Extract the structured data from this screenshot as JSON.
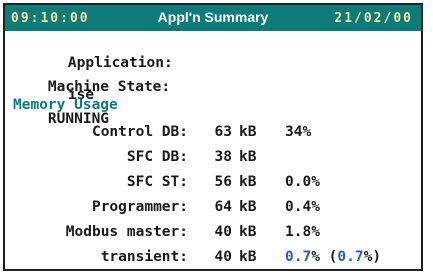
{
  "header": {
    "time": "09:10:00",
    "title": "Appl'n Summary",
    "date": "21/02/00"
  },
  "application": {
    "label": "Application:",
    "value": "ise"
  },
  "machine_state": {
    "label": "Machine State:",
    "value": "RUNNING"
  },
  "memory": {
    "title": "Memory Usage",
    "unit": "kB",
    "rows": [
      {
        "label": "Control DB:",
        "value": "63",
        "pct": "34%"
      },
      {
        "label": "SFC DB:",
        "value": "38",
        "pct": ""
      },
      {
        "label": "SFC ST:",
        "value": "56",
        "pct": "0.0%"
      },
      {
        "label": "Programmer:",
        "value": "64",
        "pct": "0.4%"
      },
      {
        "label": "Modbus master:",
        "value": "40",
        "pct": "1.8%"
      }
    ],
    "transient": {
      "label": "transient:",
      "value": "40",
      "pct_a": "0.7",
      "pct_a_suffix": "%",
      "open_paren": " (",
      "pct_b": "0.7",
      "close": "%)"
    }
  },
  "colors": {
    "header_bg": "#0e7a7a",
    "header_text": "#f2e6a0",
    "section_title": "#0e7a7a",
    "highlight_value": "#2a5fb0"
  }
}
